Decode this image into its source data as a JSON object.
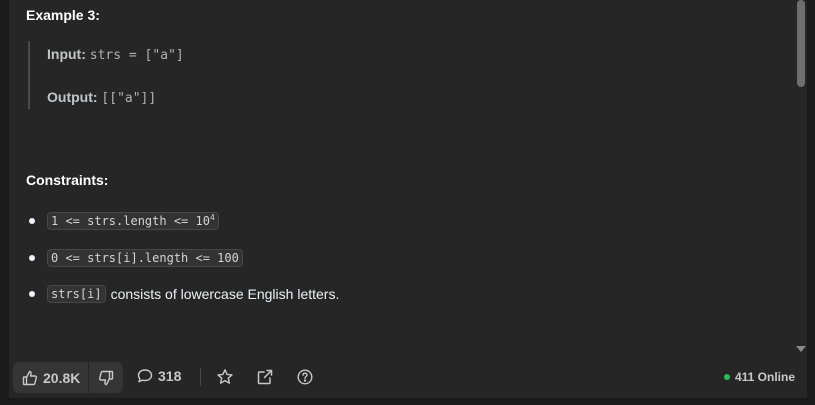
{
  "example": {
    "title": "Example 3:",
    "input_label": "Input:",
    "input_value": "strs = [\"a\"]",
    "output_label": "Output:",
    "output_value": "[[\"a\"]]"
  },
  "constraints": {
    "title": "Constraints:",
    "items": [
      {
        "code": "1 <= strs.length <= 10",
        "sup": "4",
        "text": ""
      },
      {
        "code": "0 <= strs[i].length <= 100",
        "text": ""
      },
      {
        "code": "strs[i]",
        "text": "consists of lowercase English letters."
      }
    ]
  },
  "toolbar": {
    "likes": "20.8K",
    "comments": "318",
    "online_text": "411 Online",
    "online_color": "#2cbb5d"
  },
  "icons": [
    "thumbs-up-icon",
    "thumbs-down-icon",
    "comment-icon",
    "star-icon",
    "share-icon",
    "help-icon"
  ]
}
